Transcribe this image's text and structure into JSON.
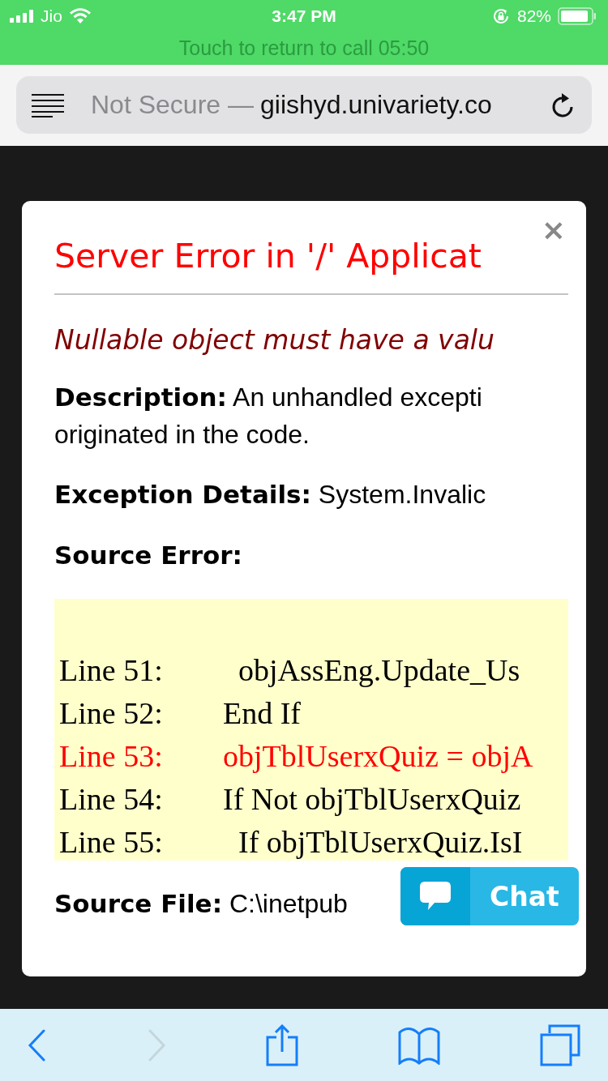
{
  "status_bar": {
    "carrier": "Jio",
    "time": "3:47 PM",
    "battery": "82%",
    "call_banner": "Touch to return to call 05:50"
  },
  "address_bar": {
    "security": "Not Secure —",
    "domain": "giishyd.univariety.co"
  },
  "error_dialog": {
    "close": "×",
    "title": "Server Error in '/' Applicat",
    "message": "Nullable object must have a valu",
    "description_lines": [
      "**Description:** An unhandled excepti",
      "originated in the code."
    ],
    "exception_details": "**Exception Details:** System.Invalic",
    "source_error_heading": "Source Error:",
    "code_lines": [
      {
        "label": "Line 51:",
        "code": "  objAssEng.Update_Us",
        "highlighted": false
      },
      {
        "label": "Line 52:",
        "code": "End If",
        "highlighted": false
      },
      {
        "label": "Line 53:",
        "code": "objTblUserxQuiz = objA",
        "highlighted": true
      },
      {
        "label": "Line 54:",
        "code": "If Not objTblUserxQuiz",
        "highlighted": false
      },
      {
        "label": "Line 55:",
        "code": "  If objTblUserxQuiz.IsI",
        "highlighted": false
      }
    ],
    "source_file": "**Source File:** C:\\inetpub"
  },
  "chat_button": {
    "label": "Chat"
  }
}
